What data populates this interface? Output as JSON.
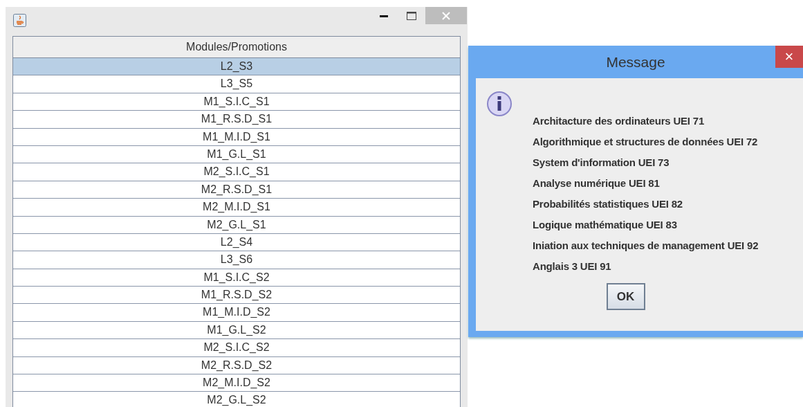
{
  "table": {
    "header": "Modules/Promotions",
    "rows": [
      {
        "label": "L2_S3",
        "selected": true
      },
      {
        "label": "L3_S5",
        "selected": false
      },
      {
        "label": "M1_S.I.C_S1",
        "selected": false
      },
      {
        "label": "M1_R.S.D_S1",
        "selected": false
      },
      {
        "label": "M1_M.I.D_S1",
        "selected": false
      },
      {
        "label": "M1_G.L_S1",
        "selected": false
      },
      {
        "label": "M2_S.I.C_S1",
        "selected": false
      },
      {
        "label": "M2_R.S.D_S1",
        "selected": false
      },
      {
        "label": "M2_M.I.D_S1",
        "selected": false
      },
      {
        "label": "M2_G.L_S1",
        "selected": false
      },
      {
        "label": "L2_S4",
        "selected": false
      },
      {
        "label": "L3_S6",
        "selected": false
      },
      {
        "label": "M1_S.I.C_S2",
        "selected": false
      },
      {
        "label": "M1_R.S.D_S2",
        "selected": false
      },
      {
        "label": "M1_M.I.D_S2",
        "selected": false
      },
      {
        "label": "M1_G.L_S2",
        "selected": false
      },
      {
        "label": "M2_S.I.C_S2",
        "selected": false
      },
      {
        "label": "M2_R.S.D_S2",
        "selected": false
      },
      {
        "label": "M2_M.I.D_S2",
        "selected": false
      },
      {
        "label": "M2_G.L_S2",
        "selected": false
      }
    ]
  },
  "dialog": {
    "title": "Message",
    "close": "×",
    "lines": [
      "Architacture des ordinateurs UEI 71",
      "Algorithmique et structures de données UEI 72",
      "System d'information UEI 73",
      "Analyse numérique UEI 81",
      "Probabilités statistiques UEI 82",
      "Logique mathématique UEI 83",
      "Iniation aux techniques de management UEI 92",
      "Anglais 3 UEI 91"
    ],
    "button": "OK"
  }
}
